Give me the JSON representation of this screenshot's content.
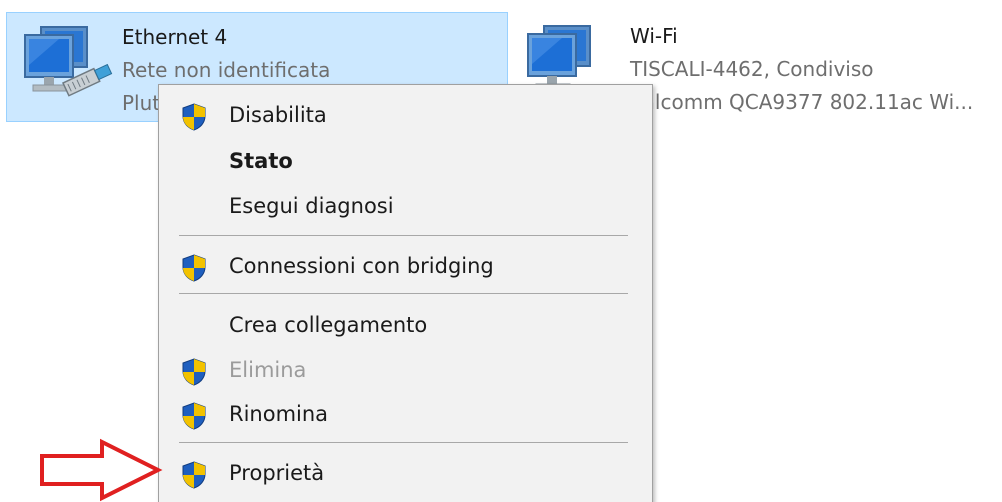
{
  "adapters": [
    {
      "name": "Ethernet 4",
      "status": "Rete non identificata",
      "device": "Plut",
      "selected": true
    },
    {
      "name": "Wi-Fi",
      "status": "TISCALI-4462, Condiviso",
      "device": "ualcomm QCA9377 802.11ac Wi..."
    }
  ],
  "context_menu": {
    "items": [
      {
        "label": "Disabilita",
        "icon": "uac-shield-icon"
      },
      {
        "label": "Stato",
        "bold": true
      },
      {
        "label": "Esegui diagnosi"
      },
      {
        "label": "Connessioni con bridging",
        "icon": "uac-shield-icon"
      },
      {
        "label": "Crea collegamento"
      },
      {
        "label": "Elimina",
        "icon": "uac-shield-icon",
        "disabled": true
      },
      {
        "label": "Rinomina",
        "icon": "uac-shield-icon"
      },
      {
        "label": "Proprietà",
        "icon": "uac-shield-icon"
      }
    ]
  },
  "colors": {
    "selection_bg": "#cce8ff",
    "selection_border": "#99d1ff",
    "menu_bg": "#f2f2f2",
    "arrow_outline": "#e02020",
    "shield_blue": "#1f5fbf",
    "shield_yellow": "#f2c200"
  }
}
